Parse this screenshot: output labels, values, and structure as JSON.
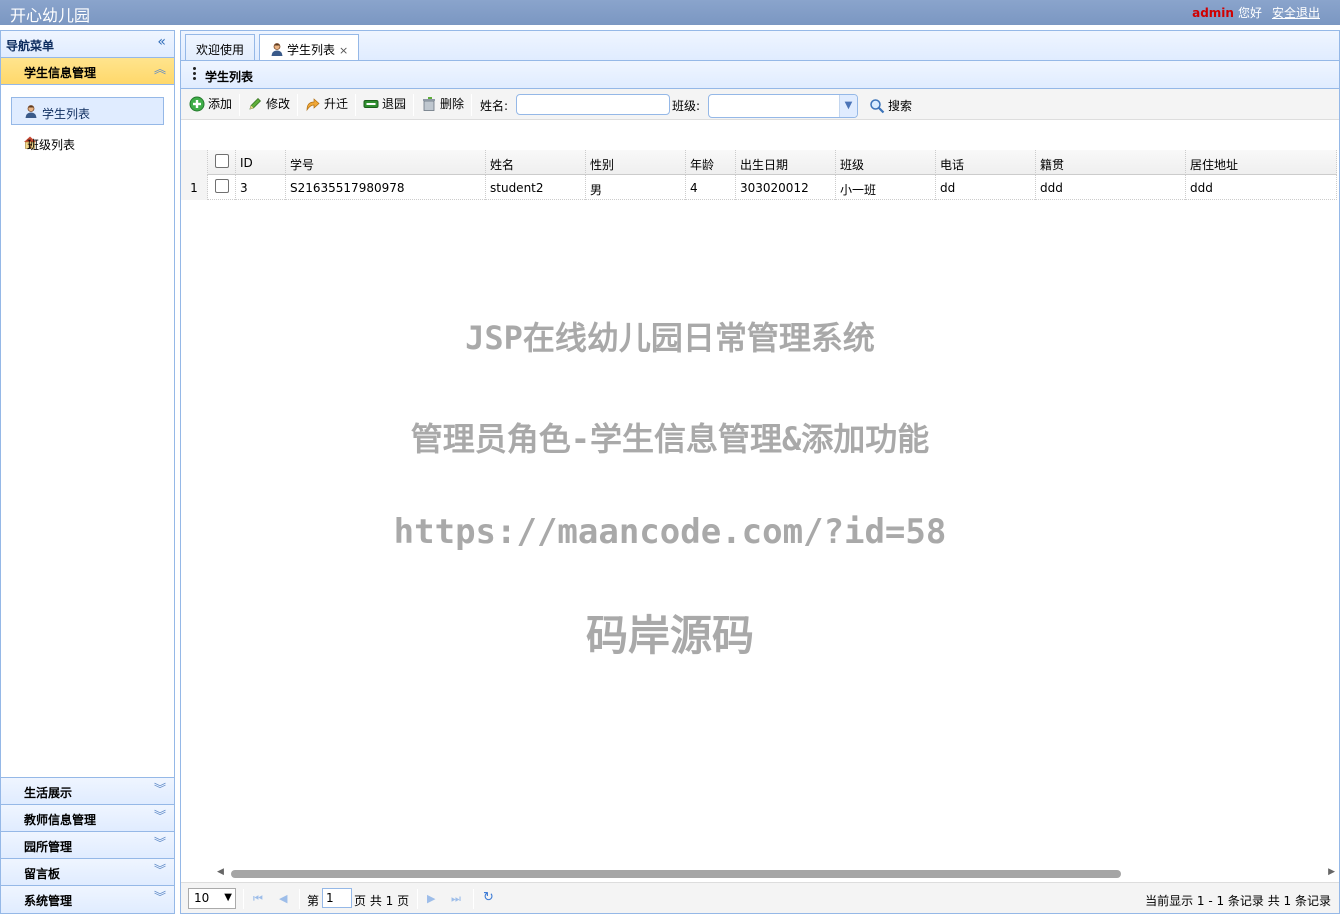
{
  "app": {
    "title": "开心幼儿园",
    "user_name": "admin",
    "greeting": "您好",
    "logout": "安全退出"
  },
  "nav": {
    "title": "导航菜单",
    "active_section": "学生信息管理",
    "items": [
      {
        "label": "学生列表",
        "icon": "student-icon"
      },
      {
        "label": "班级列表",
        "icon": "house-icon"
      }
    ],
    "sections": [
      "生活展示",
      "教师信息管理",
      "园所管理",
      "留言板",
      "系统管理"
    ]
  },
  "tabs": [
    {
      "label": "欢迎使用"
    },
    {
      "label": "学生列表"
    }
  ],
  "panel": {
    "title": "学生列表"
  },
  "toolbar": {
    "add": "添加",
    "edit": "修改",
    "promote": "升迁",
    "leave": "退园",
    "delete": "删除",
    "name_label": "姓名:",
    "name_value": "",
    "class_label": "班级:",
    "class_value": "",
    "search": "搜索"
  },
  "grid": {
    "columns": [
      "ID",
      "学号",
      "姓名",
      "性别",
      "年龄",
      "出生日期",
      "班级",
      "电话",
      "籍贯",
      "居住地址"
    ],
    "rows": [
      {
        "num": "1",
        "cells": [
          "3",
          "S21635517980978",
          "student2",
          "男",
          "4",
          "303020012",
          "小一班",
          "dd",
          "ddd",
          "ddd"
        ]
      }
    ]
  },
  "pager": {
    "page_size": "10",
    "page_prefix": "第",
    "page_value": "1",
    "page_suffix": "页 共 1 页",
    "info": "当前显示 1 - 1 条记录 共 1 条记录"
  },
  "watermark": {
    "line1": "JSP在线幼儿园日常管理系统",
    "line2": "管理员角色-学生信息管理&添加功能",
    "line3": "https://maancode.com/?id=58",
    "line4": "码岸源码"
  },
  "colors": {
    "accent": "#95b8e7",
    "header": "#7b97c2",
    "active_section": "#ffd86b",
    "username": "#d00000"
  }
}
